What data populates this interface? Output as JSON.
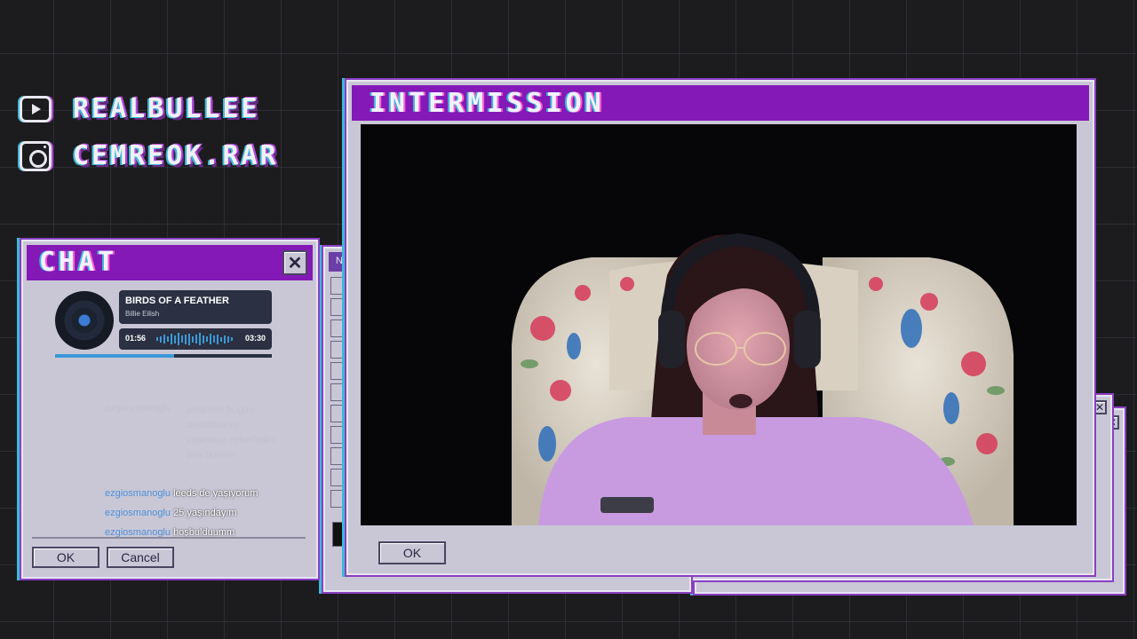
{
  "socials": [
    {
      "icon": "youtube-icon",
      "handle": "REALBULLEE"
    },
    {
      "icon": "instagram-icon",
      "handle": "CEMREOK.RAR"
    }
  ],
  "chat_window": {
    "title": "CHAT",
    "now_playing": {
      "song": "BIRDS OF A FEATHER",
      "artist": "Billie Eilish",
      "elapsed": "01:56",
      "duration": "03:30",
      "progress": 0.55
    },
    "faded_message": {
      "user": "ezgiosmanoglu",
      "lines": [
        "anlamını bugün",
        "anlatabilirim",
        "yeterince ezberledim",
        "ben bunları"
      ]
    },
    "messages": [
      {
        "user": "ezgiosmanoglu",
        "text": "leeds de yaşıyorum"
      },
      {
        "user": "ezgiosmanoglu",
        "text": "25 yaşındayım"
      },
      {
        "user": "ezgiosmanoglu",
        "text": "hoşbulduumm"
      }
    ],
    "ok_label": "OK",
    "cancel_label": "Cancel"
  },
  "paint_window": {
    "title_fragment": "Ne"
  },
  "intermission_window": {
    "title": "INTERMISSION",
    "ok_label": "OK"
  },
  "colors": {
    "title_purple": "#8419b8",
    "window_gray": "#c9c7d6",
    "accent_cyan": "#3fb8d6",
    "background": "#1c1c1f"
  }
}
